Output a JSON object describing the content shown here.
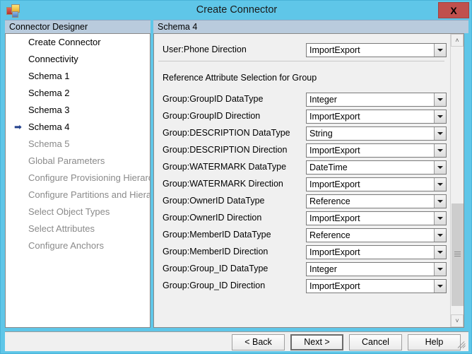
{
  "window": {
    "title": "Create Connector",
    "app_icon": "connector-designer-icon",
    "close_label": "X"
  },
  "panels": {
    "left_caption": "Connector Designer",
    "right_caption": "Schema 4"
  },
  "sidebar": {
    "current_marker": "➡",
    "items": [
      {
        "label": "Create Connector",
        "state": "done",
        "current": false
      },
      {
        "label": "Connectivity",
        "state": "done",
        "current": false
      },
      {
        "label": "Schema 1",
        "state": "done",
        "current": false
      },
      {
        "label": "Schema 2",
        "state": "done",
        "current": false
      },
      {
        "label": "Schema 3",
        "state": "done",
        "current": false
      },
      {
        "label": "Schema 4",
        "state": "done",
        "current": true
      },
      {
        "label": "Schema 5",
        "state": "disabled",
        "current": false
      },
      {
        "label": "Global Parameters",
        "state": "disabled",
        "current": false
      },
      {
        "label": "Configure Provisioning Hierarchy",
        "state": "disabled",
        "current": false
      },
      {
        "label": "Configure Partitions and Hierarchies",
        "state": "disabled",
        "current": false
      },
      {
        "label": "Select Object Types",
        "state": "disabled",
        "current": false
      },
      {
        "label": "Select Attributes",
        "state": "disabled",
        "current": false
      },
      {
        "label": "Configure Anchors",
        "state": "disabled",
        "current": false
      }
    ]
  },
  "form": {
    "top_row": {
      "label": "User:Phone Direction",
      "value": "ImportExport"
    },
    "section_title": "Reference Attribute Selection for Group",
    "rows": [
      {
        "label": "Group:GroupID DataType",
        "value": "Integer"
      },
      {
        "label": "Group:GroupID Direction",
        "value": "ImportExport"
      },
      {
        "label": "Group:DESCRIPTION DataType",
        "value": "String"
      },
      {
        "label": "Group:DESCRIPTION Direction",
        "value": "ImportExport"
      },
      {
        "label": "Group:WATERMARK DataType",
        "value": "DateTime"
      },
      {
        "label": "Group:WATERMARK Direction",
        "value": "ImportExport"
      },
      {
        "label": "Group:OwnerID DataType",
        "value": "Reference"
      },
      {
        "label": "Group:OwnerID Direction",
        "value": "ImportExport"
      },
      {
        "label": "Group:MemberID DataType",
        "value": "Reference"
      },
      {
        "label": "Group:MemberID Direction",
        "value": "ImportExport"
      },
      {
        "label": "Group:Group_ID DataType",
        "value": "Integer"
      },
      {
        "label": "Group:Group_ID Direction",
        "value": "ImportExport"
      }
    ]
  },
  "scrollbar": {
    "up_arrow": "˄",
    "down_arrow": "˅"
  },
  "footer": {
    "back_label": "< Back",
    "next_label": "Next >",
    "cancel_label": "Cancel",
    "help_label": "Help"
  },
  "colors": {
    "titlebar": "#5fc6e8",
    "close_button": "#c0504d",
    "panel_caption": "#b9cbdd",
    "content_bg": "#f0f0f0",
    "current_arrow": "#22408c"
  }
}
